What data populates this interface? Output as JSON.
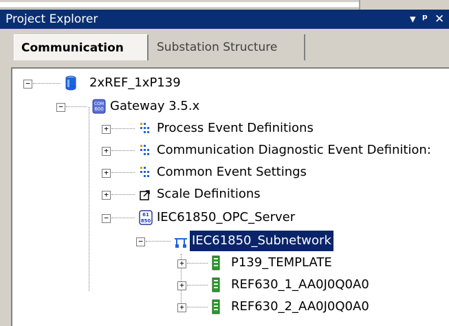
{
  "window": {
    "title": "Project Explorer",
    "pin_glyph": "▾",
    "pushpin_glyph": "ᵖ",
    "close_glyph": "✕"
  },
  "tabs": [
    {
      "label": "Communication",
      "active": true
    },
    {
      "label": "Substation Structure",
      "active": false
    }
  ],
  "tree": {
    "root": {
      "label": "2xREF_1xP139",
      "icon": "database-icon"
    },
    "gateway": {
      "label": "Gateway 3.5.x",
      "icon": "com600-icon",
      "icon_text": "COM 600"
    },
    "items": [
      {
        "label": "Process Event Definitions",
        "icon": "event-definitions-icon"
      },
      {
        "label": "Communication Diagnostic Event Definition:",
        "icon": "event-definitions-icon"
      },
      {
        "label": "Common Event Settings",
        "icon": "event-definitions-icon"
      },
      {
        "label": "Scale Definitions",
        "icon": "scale-icon"
      },
      {
        "label": "IEC61850_OPC_Server",
        "icon": "iec61850-icon",
        "icon_text": "61 850"
      }
    ],
    "subnetwork": {
      "label": "IEC61850_Subnetwork",
      "icon": "network-icon",
      "selected": true
    },
    "devices": [
      {
        "label": "P139_TEMPLATE",
        "icon": "device-icon"
      },
      {
        "label": "REF630_1_AA0J0Q0A0",
        "icon": "device-icon"
      },
      {
        "label": "REF630_2_AA0J0Q0A0",
        "icon": "device-icon"
      }
    ]
  },
  "colors": {
    "titlebar": "#0a2e73",
    "selection": "#0a246a",
    "device_green": "#2e9a2e"
  }
}
